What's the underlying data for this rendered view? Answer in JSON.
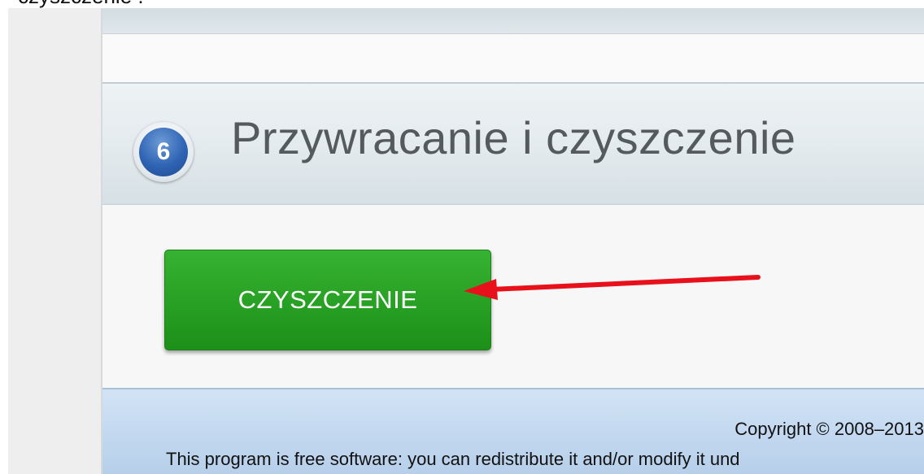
{
  "caption": {
    "text": "czyszczenie :"
  },
  "section": {
    "step_number": "6",
    "title": "Przywracanie i czyszczenie"
  },
  "actions": {
    "clean_label": "CZYSZCZENIE"
  },
  "footer": {
    "copyright": "Copyright © 2008–2013",
    "license": "This program is free software: you can redistribute it and/or modify it und"
  },
  "colors": {
    "button_green": "#27a023",
    "arrow_red": "#e8101a",
    "badge_blue": "#2f64b4",
    "title_gray": "#555a5e",
    "footer_blue": "#c4d9f0"
  },
  "icons": {
    "annotation": "red-arrow-icon",
    "step_badge": "number-circle-icon"
  }
}
